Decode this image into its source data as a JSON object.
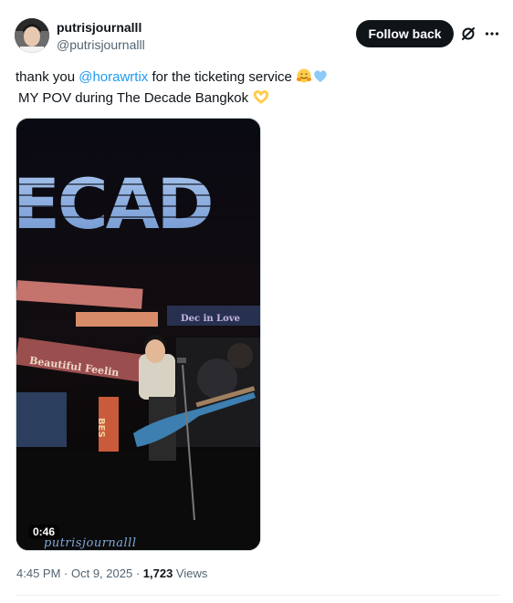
{
  "author": {
    "display_name": "putrisjournalll",
    "handle": "@putrisjournalll"
  },
  "actions": {
    "follow_label": "Follow back",
    "grok_icon": "grok-icon",
    "more_icon": "more-icon"
  },
  "tweet": {
    "line1_prefix": "thank you ",
    "mention": "@horawrtix",
    "line1_suffix": " for the ticketing service ",
    "line1_emojis": [
      "hugging-face-emoji",
      "blue-heart-emoji"
    ],
    "line2_text": "MY POV during The Decade Bangkok ",
    "line2_emojis": [
      "heart-hands-emoji"
    ]
  },
  "media": {
    "type": "video",
    "duration": "0:46",
    "watermark": "putrisjournalll",
    "scene_banner_text": "ECAD",
    "scene_sign_1": "Dec in Love",
    "scene_sign_2": "Beautiful Feelin",
    "scene_sign_3": "BES"
  },
  "meta": {
    "time": "4:45 PM",
    "separator": " · ",
    "date": "Oct 9, 2025",
    "views_count": "1,723",
    "views_label": " Views"
  },
  "colors": {
    "accent": "#1d9bf0",
    "text_primary": "#0f1419",
    "text_secondary": "#536471",
    "button_bg": "#0f1419"
  }
}
